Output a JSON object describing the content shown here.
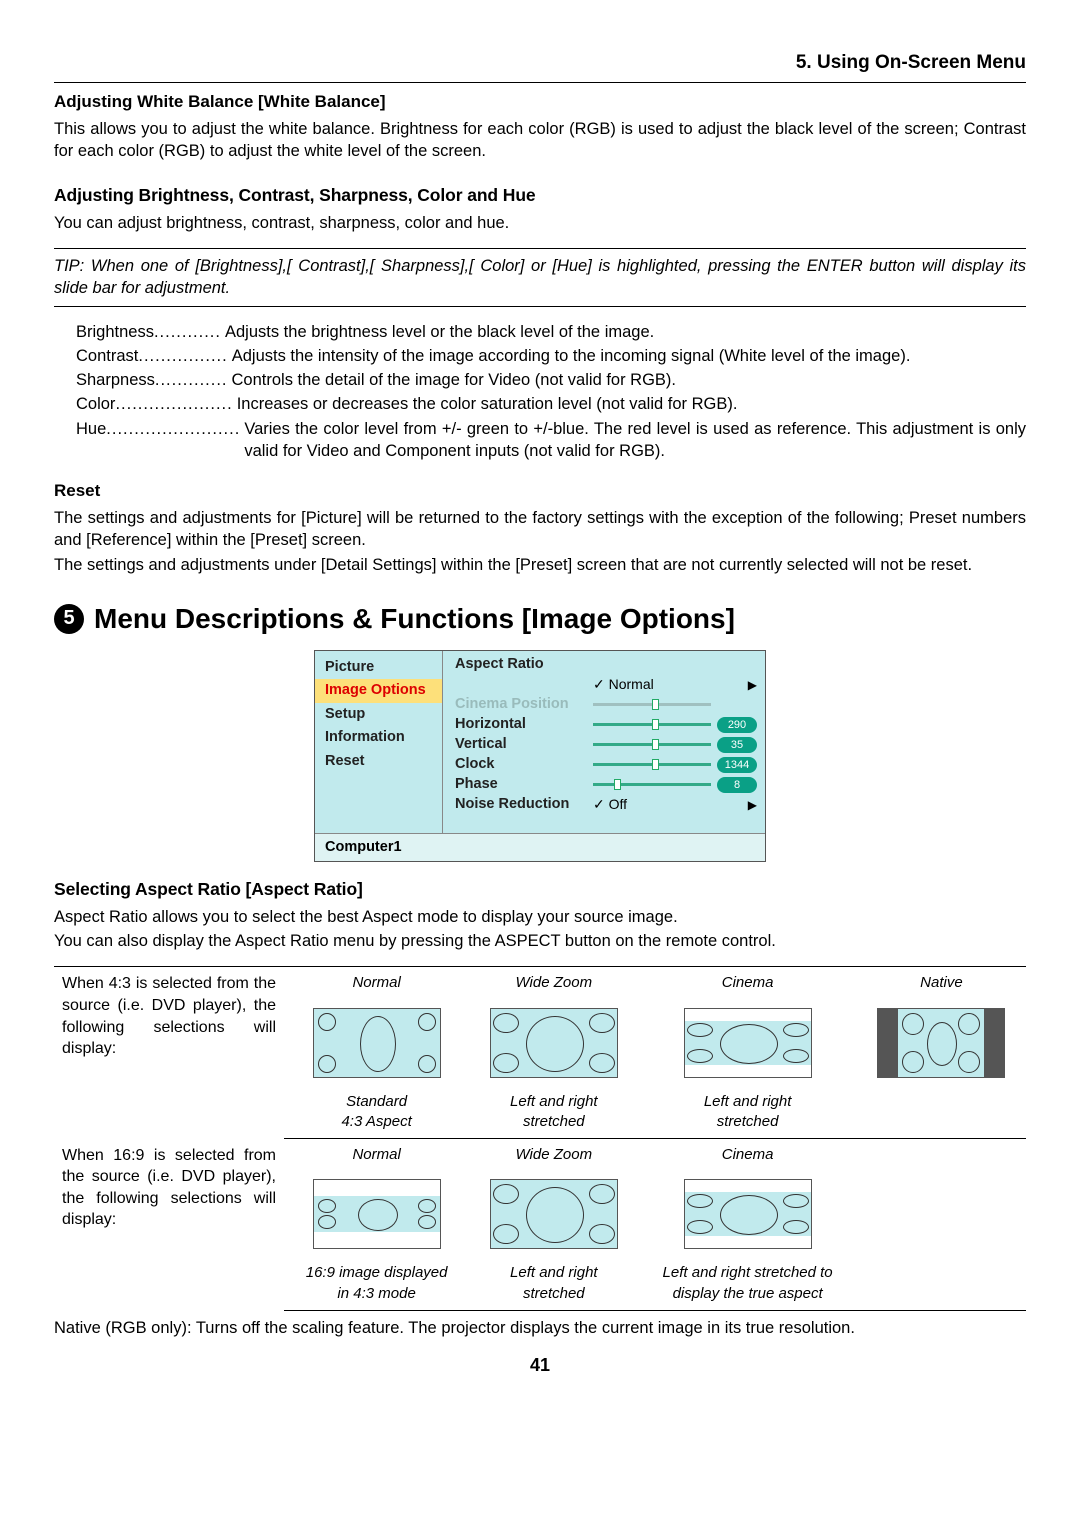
{
  "chapter": "5. Using On-Screen Menu",
  "s1": {
    "title": "Adjusting White Balance [White Balance]",
    "body": "This allows you to adjust the white balance. Brightness for each color (RGB) is used to adjust the black level of the screen; Contrast for each color (RGB) to adjust the white level of the screen."
  },
  "s2": {
    "title": "Adjusting Brightness, Contrast, Sharpness, Color and Hue",
    "body": "You can adjust brightness, contrast, sharpness, color and hue.",
    "tip": "TIP: When one of [Brightness],[ Contrast],[ Sharpness],[ Color] or [Hue] is highlighted, pressing the ENTER button will display its slide bar for adjustment.",
    "defs": [
      {
        "t": "Brightness",
        "d": "............",
        "v": "Adjusts the brightness level or the black level of the image."
      },
      {
        "t": "Contrast",
        "d": "................",
        "v": "Adjusts the intensity of the image according to the incoming signal (White level of the image)."
      },
      {
        "t": "Sharpness",
        "d": ".............",
        "v": "Controls the detail of the image for Video (not valid for RGB)."
      },
      {
        "t": "Color",
        "d": ".....................",
        "v": "Increases or decreases the color saturation level (not valid for RGB)."
      },
      {
        "t": "Hue",
        "d": "........................",
        "v": "Varies the color level from +/- green to +/-blue. The red level is used as reference. This adjustment is only valid for Video and Component inputs (not valid for RGB)."
      }
    ]
  },
  "s3": {
    "title": "Reset",
    "p1": "The settings and adjustments for [Picture] will be returned to the factory settings with the exception of the following; Preset numbers and [Reference] within the [Preset] screen.",
    "p2": "The settings and adjustments under [Detail Settings] within the [Preset] screen that are not currently selected will not be reset."
  },
  "h2": {
    "num": "5",
    "title": "Menu Descriptions & Functions [Image Options]"
  },
  "osd": {
    "sidebar": [
      "Picture",
      "Image Options",
      "Setup",
      "Information",
      "Reset"
    ],
    "active_index": 1,
    "title": "Aspect Ratio",
    "rows": [
      {
        "label": "",
        "val": "✓ Normal",
        "type": "arrow"
      },
      {
        "label": "Cinema Position",
        "type": "disabled-slider"
      },
      {
        "label": "Horizontal",
        "type": "slider",
        "badge": "290",
        "pos": 50
      },
      {
        "label": "Vertical",
        "type": "slider",
        "badge": "35",
        "pos": 50
      },
      {
        "label": "Clock",
        "type": "slider",
        "badge": "1344",
        "pos": 50
      },
      {
        "label": "Phase",
        "type": "slider",
        "badge": "8",
        "pos": 18
      },
      {
        "label": "Noise Reduction",
        "val": "✓ Off",
        "type": "arrow"
      }
    ],
    "footer": "Computer1"
  },
  "s4": {
    "title": "Selecting Aspect Ratio [Aspect Ratio]",
    "p1": "Aspect Ratio allows you to select the best Aspect mode to display your source image.",
    "p2": "You can also display the Aspect Ratio menu by pressing the ASPECT button on the remote control."
  },
  "ar": {
    "headers": [
      "Normal",
      "Wide Zoom",
      "Cinema",
      "Native"
    ],
    "row43": {
      "desc": "When 4:3 is selected from the source (i.e. DVD player), the following selections will display:",
      "subs": [
        "Standard\n4:3 Aspect",
        "Left and right\nstretched",
        "Left and right\nstretched",
        ""
      ]
    },
    "row169": {
      "desc": "When 16:9 is selected from the source (i.e. DVD player), the following selections will display:",
      "subs": [
        "16:9 image displayed\nin 4:3 mode",
        "Left and right\nstretched",
        "Left and right stretched to\ndisplay the true aspect",
        ""
      ]
    },
    "footnote": "Native (RGB only): Turns off the scaling feature. The projector displays the current image in its true resolution."
  },
  "page": "41"
}
